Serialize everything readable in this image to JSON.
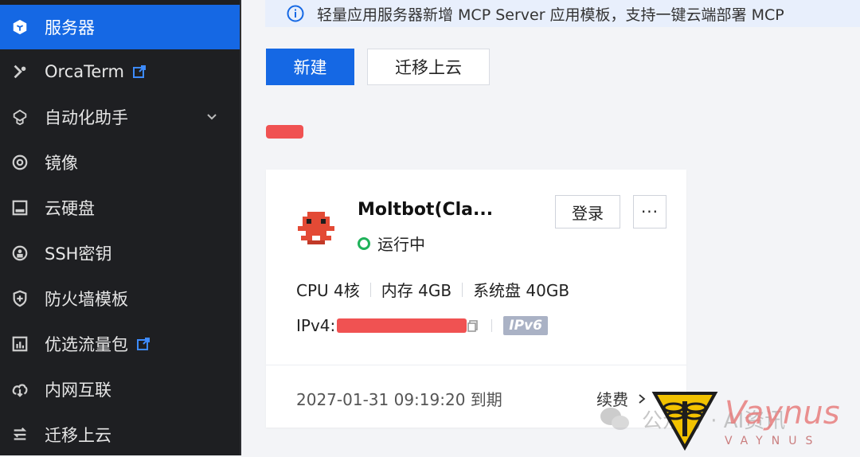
{
  "sidebar": {
    "items": [
      {
        "label": "服务器",
        "icon": "server-icon",
        "active": true
      },
      {
        "label": "OrcaTerm",
        "icon": "terminal-icon",
        "external": true
      },
      {
        "label": "自动化助手",
        "icon": "automation-icon",
        "expandable": true
      },
      {
        "label": "镜像",
        "icon": "image-icon"
      },
      {
        "label": "云硬盘",
        "icon": "disk-icon"
      },
      {
        "label": "SSH密钥",
        "icon": "ssh-key-icon"
      },
      {
        "label": "防火墙模板",
        "icon": "shield-icon"
      },
      {
        "label": "优选流量包",
        "icon": "traffic-icon",
        "external": true
      },
      {
        "label": "内网互联",
        "icon": "network-icon"
      },
      {
        "label": "迁移上云",
        "icon": "migrate-icon"
      }
    ]
  },
  "notice": {
    "text": "轻量应用服务器新增 MCP Server 应用模板，支持一键云端部署 MCP"
  },
  "toolbar": {
    "new_label": "新建",
    "migrate_label": "迁移上云"
  },
  "instance": {
    "name": "Moltbot(Cla...",
    "status": "运行中",
    "login_label": "登录",
    "more_label": "···",
    "cpu": "CPU 4核",
    "memory": "内存 4GB",
    "disk": "系统盘 40GB",
    "ip_label": "IPv4:",
    "ipv6_label": "IPv6",
    "expire": "2027-01-31 09:19:20 到期",
    "renew_label": "续费"
  },
  "watermark": {
    "text": "公众号 · AI资讯",
    "brand": "Vaynus",
    "brand_sub": "VAYNUS"
  },
  "colors": {
    "accent": "#1568e4",
    "sidebar_bg": "#1e1f22",
    "status_green": "#1fb25a",
    "redaction": "#f05252"
  }
}
